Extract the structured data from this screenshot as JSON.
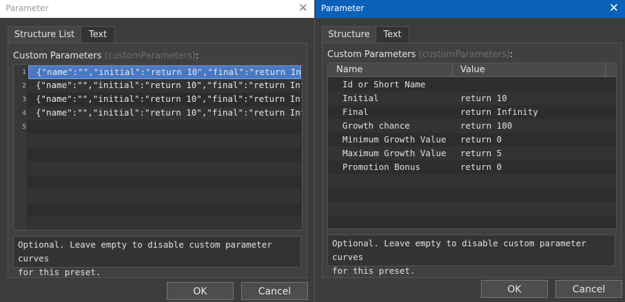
{
  "left": {
    "title": "Parameter",
    "tabs": [
      "Structure List",
      "Text"
    ],
    "section_label": "Custom Parameters",
    "section_hint": "(customParameters)",
    "section_colon": ":",
    "lines": [
      {
        "num": "1",
        "text": "{\"name\":\"\",\"initial\":\"return 10\",\"final\":\"return Inf…"
      },
      {
        "num": "2",
        "text": "{\"name\":\"\",\"initial\":\"return 10\",\"final\":\"return Inf…"
      },
      {
        "num": "3",
        "text": "{\"name\":\"\",\"initial\":\"return 10\",\"final\":\"return Inf…"
      },
      {
        "num": "4",
        "text": "{\"name\":\"\",\"initial\":\"return 10\",\"final\":\"return Inf…"
      },
      {
        "num": "5",
        "text": ""
      }
    ],
    "description": "Optional. Leave empty to disable custom parameter curves\nfor this preset.",
    "ok": "OK",
    "cancel": "Cancel"
  },
  "right": {
    "title": "Parameter",
    "tabs": [
      "Structure",
      "Text"
    ],
    "section_label": "Custom Parameters",
    "section_hint": "(customParameters)",
    "section_colon": ":",
    "columns": [
      "Name",
      "Value"
    ],
    "rows": [
      {
        "name": "Id or Short Name",
        "value": ""
      },
      {
        "name": "Initial",
        "value": "return 10"
      },
      {
        "name": "Final",
        "value": "return Infinity"
      },
      {
        "name": "Growth chance",
        "value": "return 100"
      },
      {
        "name": "Minimum Growth Value",
        "value": "return 0"
      },
      {
        "name": "Maximum Growth Value",
        "value": "return 5"
      },
      {
        "name": "Promotion Bonus",
        "value": "return 0"
      }
    ],
    "description": "Optional. Leave empty to disable custom parameter curves\nfor this preset.",
    "ok": "OK",
    "cancel": "Cancel"
  }
}
